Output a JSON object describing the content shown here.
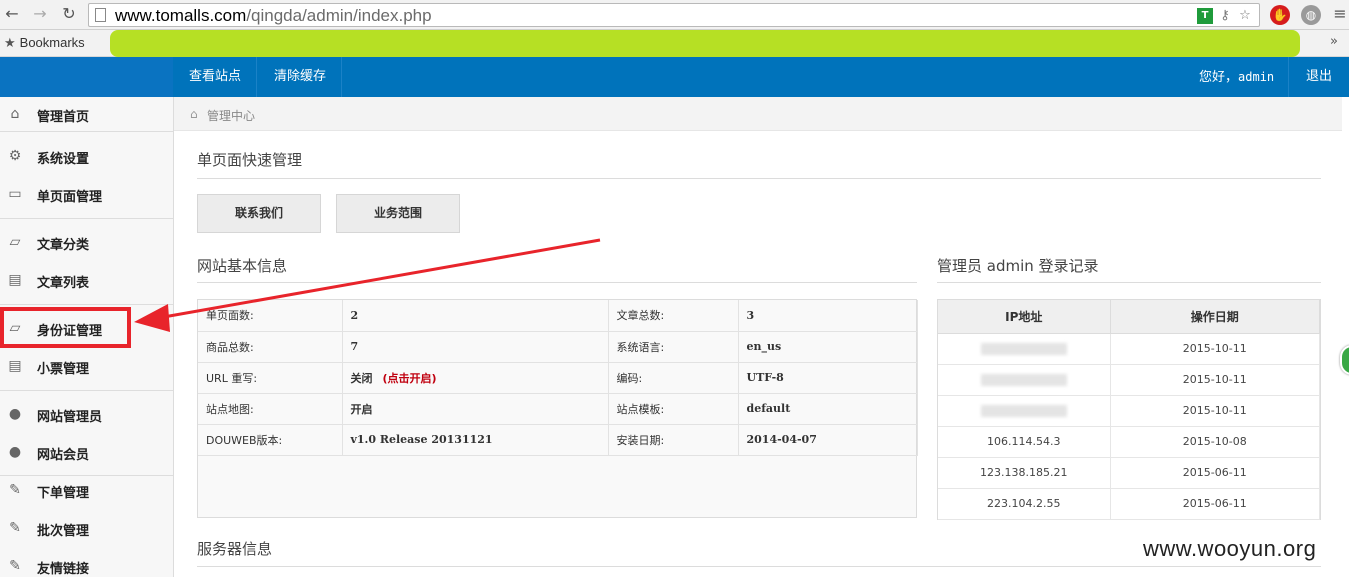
{
  "browser": {
    "url_domain": "www.tomalls.com",
    "url_path": "/qingda/admin/index.php",
    "bookmarks_label": "Bookmarks"
  },
  "header": {
    "links": [
      "查看站点",
      "清除缓存"
    ],
    "greeting": "您好，",
    "user": "admin",
    "logout": "退出"
  },
  "sidebar": {
    "items": [
      {
        "label": "管理首页",
        "icon": "home-icon"
      },
      {
        "label": "系统设置",
        "icon": "gear-icon"
      },
      {
        "label": "单页面管理",
        "icon": "monitor-icon"
      },
      {
        "label": "文章分类",
        "icon": "folder-icon"
      },
      {
        "label": "文章列表",
        "icon": "list-icon"
      },
      {
        "label": "身份证管理",
        "icon": "folder-icon"
      },
      {
        "label": "小票管理",
        "icon": "list-icon"
      },
      {
        "label": "网站管理员",
        "icon": "user-icon"
      },
      {
        "label": "网站会员",
        "icon": "user-icon"
      },
      {
        "label": "下单管理",
        "icon": "pencil-icon"
      },
      {
        "label": "批次管理",
        "icon": "pencil-icon"
      },
      {
        "label": "友情链接",
        "icon": "pencil-icon"
      }
    ]
  },
  "breadcrumb": {
    "label": "管理中心"
  },
  "quick": {
    "title": "单页面快速管理",
    "buttons": [
      "联系我们",
      "业务范围"
    ]
  },
  "site_info": {
    "title": "网站基本信息",
    "rows": [
      {
        "k1": "单页面数:",
        "v1": "2",
        "k2": "文章总数:",
        "v2": "3"
      },
      {
        "k1": "商品总数:",
        "v1": "7",
        "k2": "系统语言:",
        "v2": "en_us"
      },
      {
        "k1": "URL 重写:",
        "v1": "关闭",
        "v1_link": "(点击开启)",
        "k2": "编码:",
        "v2": "UTF-8"
      },
      {
        "k1": "站点地图:",
        "v1": "开启",
        "k2": "站点模板:",
        "v2": "default"
      },
      {
        "k1": "DOUWEB版本:",
        "v1": "v1.0 Release 20131121",
        "k2": "安装日期:",
        "v2": "2014-04-07"
      }
    ]
  },
  "login_log": {
    "title": "管理员 admin 登录记录",
    "headers": [
      "IP地址",
      "操作日期"
    ],
    "rows": [
      {
        "ip": "",
        "date": "2015-10-11"
      },
      {
        "ip": "",
        "date": "2015-10-11"
      },
      {
        "ip": "",
        "date": "2015-10-11"
      },
      {
        "ip": "106.114.54.3",
        "date": "2015-10-08"
      },
      {
        "ip": "123.138.185.21",
        "date": "2015-06-11"
      },
      {
        "ip": "223.104.2.55",
        "date": "2015-06-11"
      }
    ]
  },
  "server_info": {
    "title": "服务器信息"
  },
  "watermark": "www.wooyun.org",
  "colors": {
    "header": "#0073bb",
    "annotation": "#e8242b",
    "redaction": "#b6e024"
  }
}
